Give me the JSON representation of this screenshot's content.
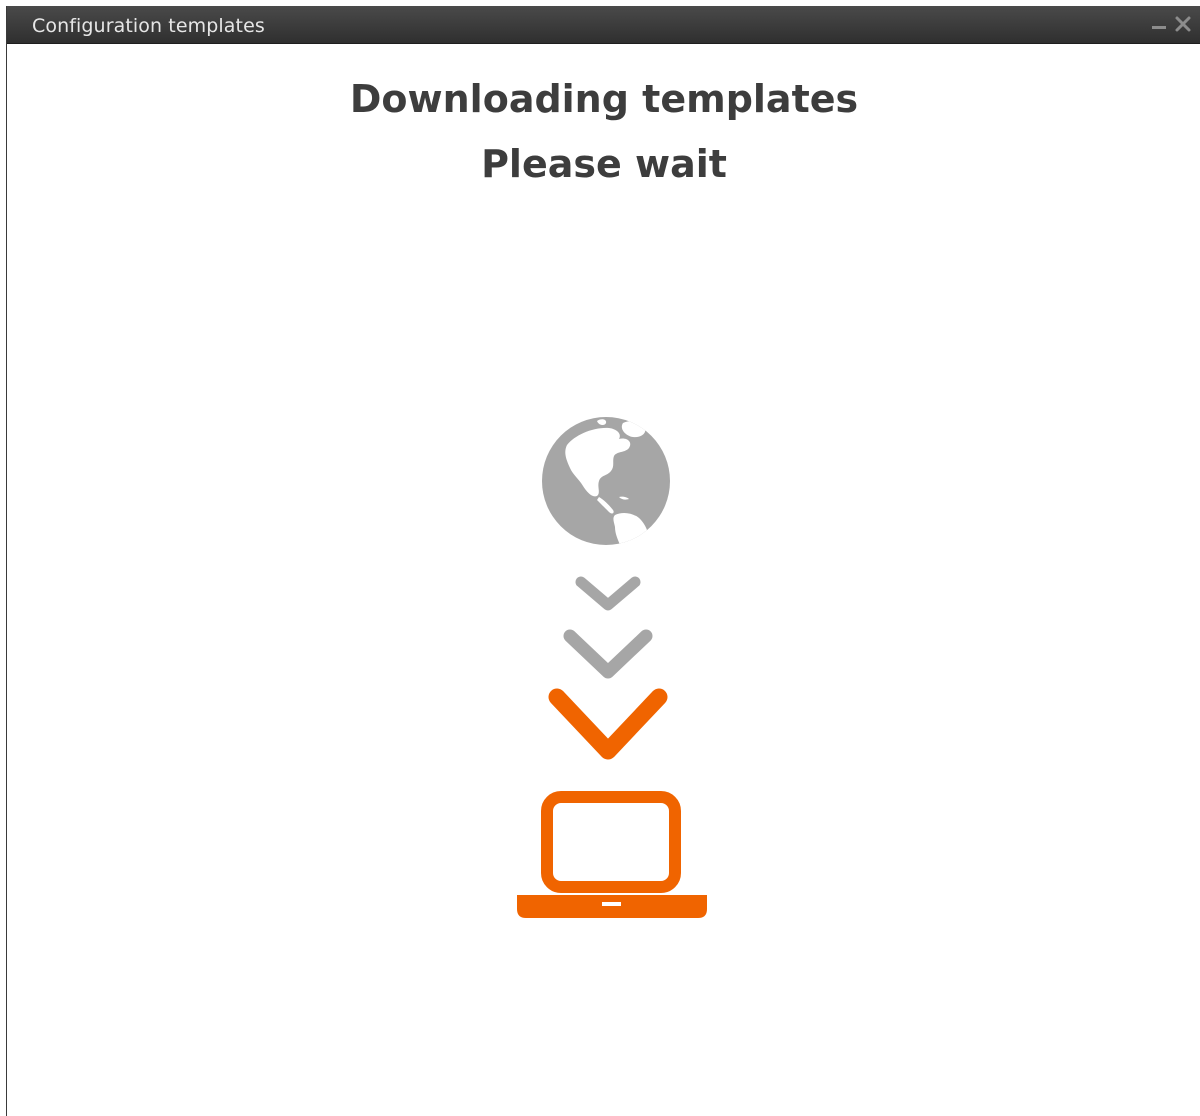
{
  "window": {
    "title": "Configuration templates",
    "controls": [
      "minimize-icon",
      "close-icon"
    ]
  },
  "content": {
    "heading": "Downloading templates",
    "subheading": "Please wait"
  },
  "illustration": {
    "icons": [
      "globe-icon",
      "chevron-down-icon",
      "chevron-down-icon",
      "chevron-down-icon",
      "laptop-icon"
    ],
    "colors": {
      "gray": "#a6a6a6",
      "accent": "#f06400",
      "text": "#3d3d3d",
      "titlebar": "#3a3a3a"
    }
  }
}
